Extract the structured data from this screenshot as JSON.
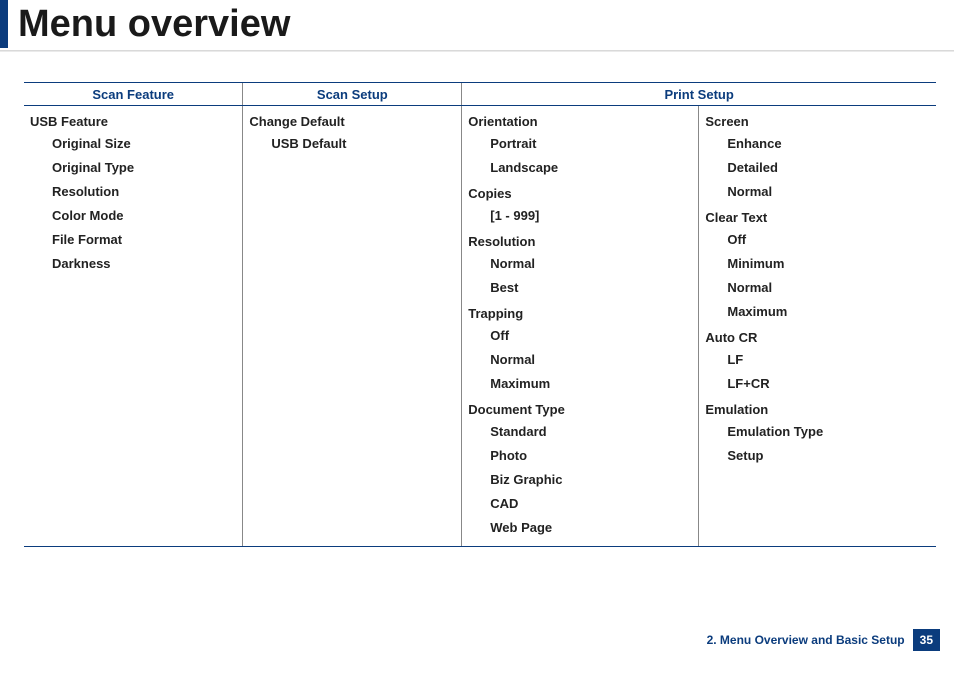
{
  "title": "Menu overview",
  "table": {
    "headers": [
      "Scan Feature",
      "Scan Setup",
      "Print Setup"
    ],
    "scan_feature": {
      "group": "USB Feature",
      "items": [
        "Original Size",
        "Original Type",
        "Resolution",
        "Color Mode",
        "File Format",
        "Darkness"
      ]
    },
    "scan_setup": {
      "group": "Change Default",
      "items": [
        "USB Default"
      ]
    },
    "print_setup_left": [
      {
        "name": "Orientation",
        "items": [
          "Portrait",
          "Landscape"
        ]
      },
      {
        "name": "Copies",
        "items": [
          "[1 - 999]"
        ]
      },
      {
        "name": "Resolution",
        "items": [
          "Normal",
          "Best"
        ]
      },
      {
        "name": "Trapping",
        "items": [
          "Off",
          "Normal",
          "Maximum"
        ]
      },
      {
        "name": "Document Type",
        "items": [
          "Standard",
          "Photo",
          "Biz Graphic",
          "CAD",
          "Web Page"
        ]
      }
    ],
    "print_setup_right": [
      {
        "name": "Screen",
        "items": [
          "Enhance",
          "Detailed",
          "Normal"
        ]
      },
      {
        "name": "Clear Text",
        "items": [
          "Off",
          "Minimum",
          "Normal",
          "Maximum"
        ]
      },
      {
        "name": "Auto CR",
        "items": [
          "LF",
          "LF+CR"
        ]
      },
      {
        "name": "Emulation",
        "items": [
          "Emulation Type",
          "Setup"
        ]
      }
    ]
  },
  "footer": {
    "chapter": "2. Menu Overview and Basic Setup",
    "page": "35"
  }
}
